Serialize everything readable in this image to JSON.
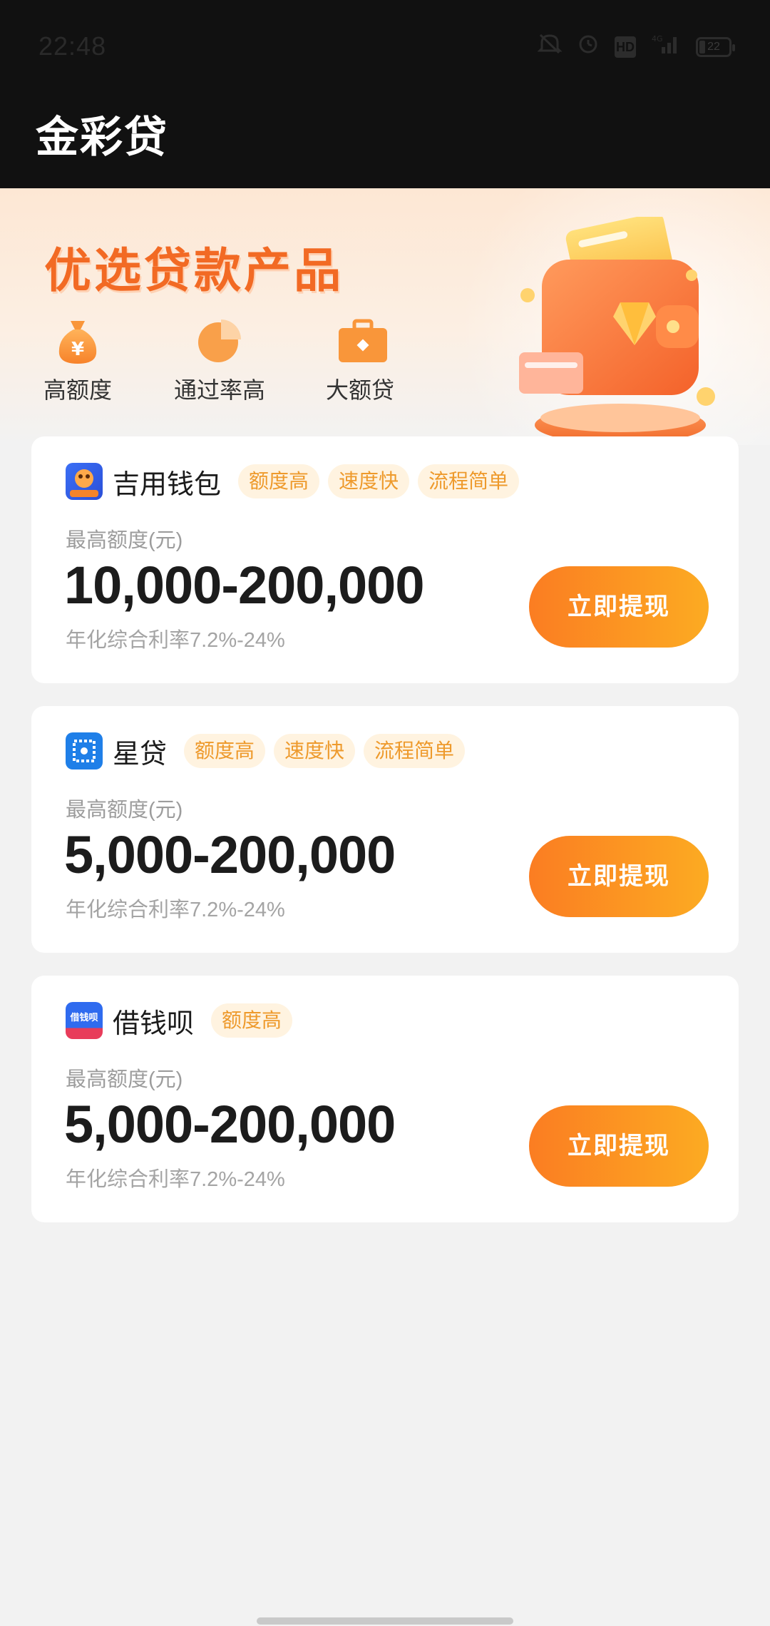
{
  "status_bar": {
    "time": "22:48",
    "network": "4G",
    "hd": "HD",
    "battery": "22",
    "icons": [
      "mute-icon",
      "alarm-icon",
      "hd-icon",
      "signal-icon",
      "battery-icon"
    ]
  },
  "header": {
    "title": "金彩贷"
  },
  "banner": {
    "headline": "优选贷款产品",
    "features": [
      {
        "icon": "money-bag-icon",
        "label": "高额度"
      },
      {
        "icon": "pie-chart-icon",
        "label": "通过率高"
      },
      {
        "icon": "briefcase-icon",
        "label": "大额贷"
      }
    ],
    "illustration": "wallet-illustration"
  },
  "products": [
    {
      "name": "吉用钱包",
      "logo": "jiyong-wallet-logo",
      "tags": [
        "额度高",
        "速度快",
        "流程简单"
      ],
      "amount_label": "最高额度(元)",
      "amount": "10,000-200,000",
      "rate": "年化综合利率7.2%-24%",
      "cta": "立即提现"
    },
    {
      "name": "星贷",
      "logo": "xingdai-logo",
      "tags": [
        "额度高",
        "速度快",
        "流程简单"
      ],
      "amount_label": "最高额度(元)",
      "amount": "5,000-200,000",
      "rate": "年化综合利率7.2%-24%",
      "cta": "立即提现"
    },
    {
      "name": "借钱呗",
      "logo": "jieqianbei-logo",
      "logo_text": "借钱呗",
      "tags": [
        "额度高"
      ],
      "amount_label": "最高额度(元)",
      "amount": "5,000-200,000",
      "rate": "年化综合利率7.2%-24%",
      "cta": "立即提现"
    }
  ],
  "colors": {
    "accent_orange": "#f26a24",
    "button_gradient_start": "#fb7d22",
    "button_gradient_end": "#fcab22",
    "tag_bg": "#fff3e0",
    "tag_text": "#ee9a2c",
    "header_bg": "#111111",
    "page_bg": "#f2f2f2"
  }
}
